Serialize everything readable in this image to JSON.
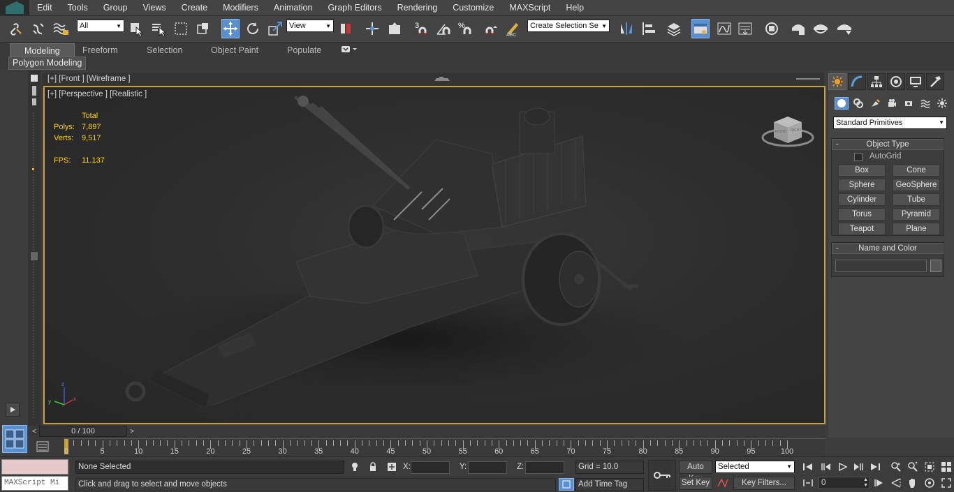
{
  "menubar": {
    "items": [
      "Edit",
      "Tools",
      "Group",
      "Views",
      "Create",
      "Modifiers",
      "Animation",
      "Graph Editors",
      "Rendering",
      "Customize",
      "MAXScript",
      "Help"
    ]
  },
  "toolbar": {
    "filter_value": "All",
    "refcoord_value": "View",
    "selection_set_placeholder": "Create Selection Se",
    "icons": [
      "link-icon",
      "unlink-icon",
      "bind-space-warp-icon",
      "select-object-icon",
      "select-by-name-icon",
      "rectangle-region-icon",
      "window-crossing-icon",
      "move-icon",
      "rotate-icon",
      "scale-icon",
      "pivot-icon",
      "snaps-3d-icon",
      "angle-snap-icon",
      "percent-snap-icon",
      "spinner-snap-icon",
      "edit-named-sets-icon",
      "mirror-icon",
      "align-icon",
      "layer-manager-icon",
      "scene-explorer-icon",
      "curve-editor-icon",
      "schematic-view-icon",
      "material-editor-icon",
      "render-setup-icon",
      "rendered-frame-icon",
      "render-icon"
    ]
  },
  "ribbon": {
    "tabs": [
      "Modeling",
      "Freeform",
      "Selection",
      "Object Paint",
      "Populate"
    ],
    "active_tab": "Modeling",
    "panel_label": "Polygon Modeling"
  },
  "viewports": {
    "front_label": "[+] [Front ] [Wireframe ]",
    "perspective_label": "[+] [Perspective ] [Realistic ]",
    "stats": {
      "header": "Total",
      "polys_label": "Polys:",
      "polys_value": "7,897",
      "verts_label": "Verts:",
      "verts_value": "9,517",
      "fps_label": "FPS:",
      "fps_value": "11.137"
    },
    "viewcube_labels": [
      "TOP",
      "FRONT",
      "RIGHT"
    ],
    "axis_labels": [
      "x",
      "y",
      "z"
    ]
  },
  "command_panel": {
    "tabs": [
      "create-tab",
      "modify-tab",
      "hierarchy-tab",
      "motion-tab",
      "display-tab",
      "utilities-tab"
    ],
    "categories": [
      "geometry",
      "shapes",
      "lights",
      "cameras",
      "helpers",
      "space-warps",
      "systems"
    ],
    "primitive_dropdown": "Standard Primitives",
    "object_type_title": "Object Type",
    "autogrid_label": "AutoGrid",
    "object_buttons": [
      "Box",
      "Cone",
      "Sphere",
      "GeoSphere",
      "Cylinder",
      "Tube",
      "Torus",
      "Pyramid",
      "Teapot",
      "Plane"
    ],
    "name_color_title": "Name and Color",
    "name_value": "",
    "object_color": "#555555"
  },
  "timeline": {
    "slider_text": "0 / 100",
    "ticks": [
      "0",
      "5",
      "10",
      "15",
      "20",
      "25",
      "30",
      "35",
      "40",
      "45",
      "50",
      "55",
      "60",
      "65",
      "70",
      "75",
      "80",
      "85",
      "90",
      "95",
      "100"
    ]
  },
  "statusbar": {
    "maxscript_placeholder": "MAXScript Mi",
    "selection_status": "None Selected",
    "prompt": "Click and drag to select and move objects",
    "x_label": "X:",
    "y_label": "Y:",
    "z_label": "Z:",
    "grid": "Grid = 10.0",
    "add_time_tag": "Add Time Tag",
    "auto_key": "Auto Key",
    "set_key": "Set Key",
    "key_mode": "Selected",
    "key_filters": "Key Filters...",
    "current_frame": "0"
  },
  "colors": {
    "viewport_border": "#c9a33a",
    "active_blue": "#5a8fd0",
    "stats_yellow": "#ffd400"
  }
}
